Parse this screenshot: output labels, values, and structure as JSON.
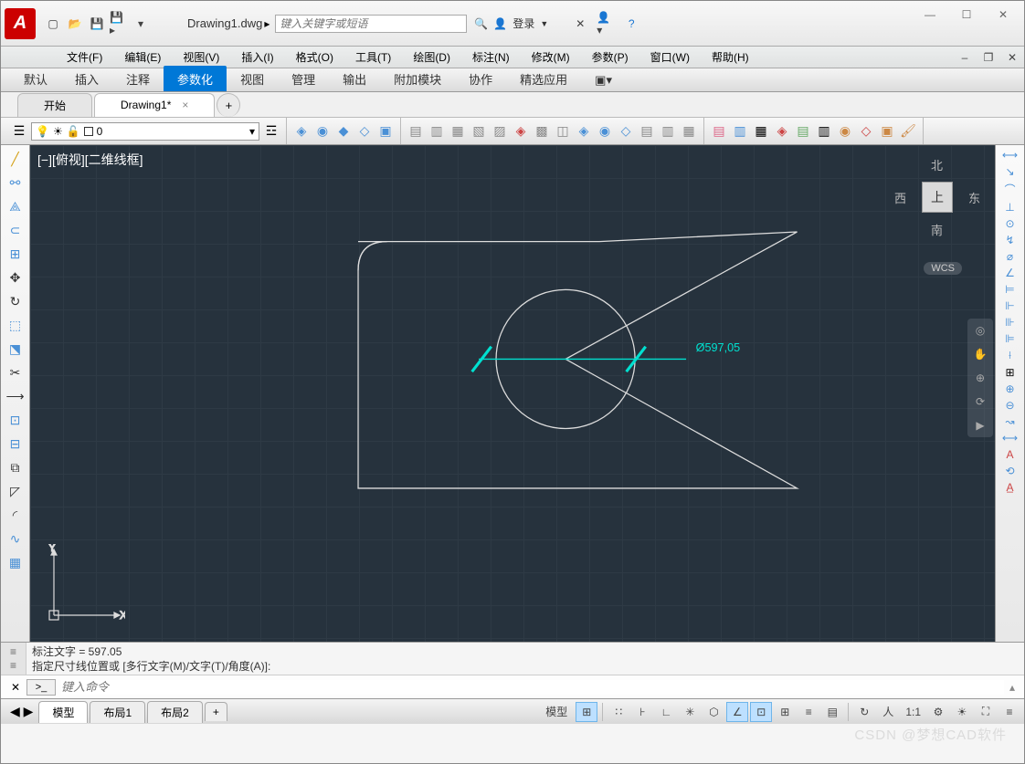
{
  "title": "Drawing1.dwg",
  "search_ph": "键入关键字或短语",
  "login": "登录",
  "menus": [
    "文件(F)",
    "编辑(E)",
    "视图(V)",
    "插入(I)",
    "格式(O)",
    "工具(T)",
    "绘图(D)",
    "标注(N)",
    "修改(M)",
    "参数(P)",
    "窗口(W)",
    "帮助(H)"
  ],
  "ribbon": [
    "默认",
    "插入",
    "注释",
    "参数化",
    "视图",
    "管理",
    "输出",
    "附加模块",
    "协作",
    "精选应用"
  ],
  "ribbon_active": 3,
  "doctabs": [
    {
      "label": "开始",
      "active": false,
      "close": false
    },
    {
      "label": "Drawing1*",
      "active": true,
      "close": true
    }
  ],
  "layer": "0",
  "view_label": "[−][俯视][二维线框]",
  "compass": {
    "n": "北",
    "s": "南",
    "e": "东",
    "w": "西",
    "top": "上"
  },
  "wcs": "WCS",
  "dimension": "Ø597,05",
  "cmd_hist": [
    "标注文字 = 597.05",
    "指定尺寸线位置或 [多行文字(M)/文字(T)/角度(A)]:"
  ],
  "cmd_ph": "键入命令",
  "cmd_prompt": ">_",
  "layout_tabs": [
    "模型",
    "布局1",
    "布局2"
  ],
  "layout_model": "模型",
  "scale": "1:1",
  "watermark": "CSDN @梦想CAD软件"
}
